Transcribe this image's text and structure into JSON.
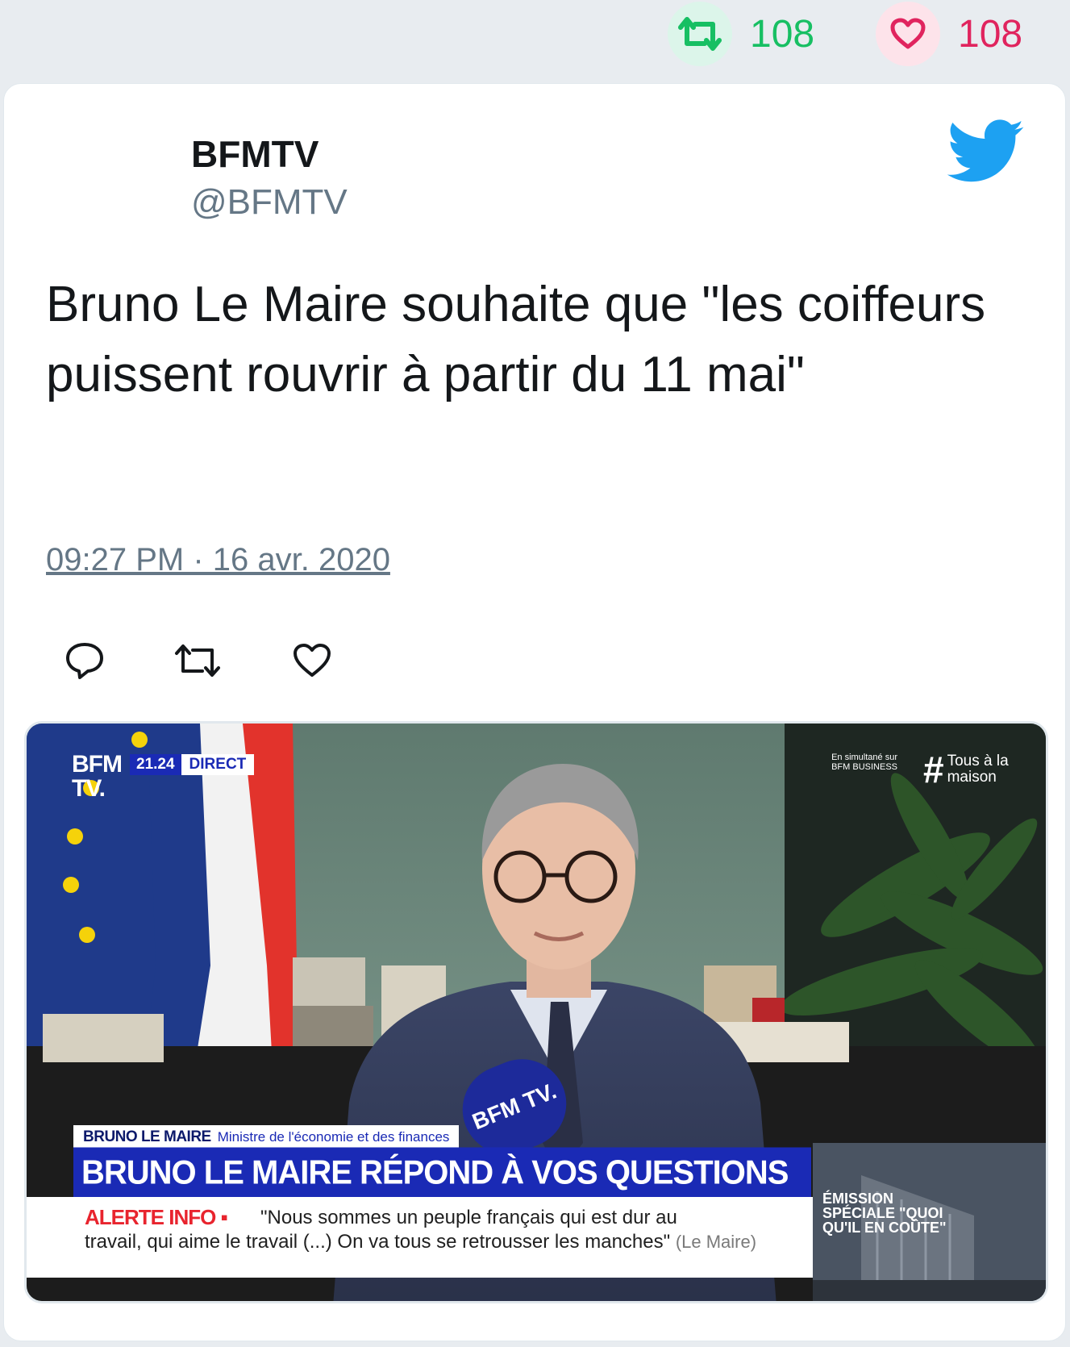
{
  "stats": {
    "retweets": "108",
    "likes": "108",
    "retweet_icon": "retweet-icon",
    "like_icon": "heart-icon"
  },
  "author": {
    "name": "BFMTV",
    "handle": "@BFMTV"
  },
  "tweet": {
    "text": "Bruno Le Maire souhaite que \"les coiffeurs puissent rouvrir à partir du 11 mai\"",
    "timestamp": "09:27 PM · 16 avr. 2020"
  },
  "actions": [
    "reply-icon",
    "retweet-icon",
    "like-icon"
  ],
  "media": {
    "channel_logo_line1": "BFM",
    "channel_logo_line2": "TV.",
    "live_time": "21.24",
    "live_label": "DIRECT",
    "simulcast": "En simultané sur BFM BUSINESS",
    "hashtag_symbol": "#",
    "hashtag_text_1": "Tous à la",
    "hashtag_text_2": "maison",
    "mic_label": "BFM TV.",
    "nameplate_name": "BRUNO LE MAIRE",
    "nameplate_role": "Ministre de l'économie et des finances",
    "headline": "BRUNO LE MAIRE RÉPOND À VOS QUESTIONS",
    "alert_label": "ALERTE INFO ▪",
    "alert_line1": "\"Nous sommes un peuple français qui est dur au",
    "alert_line2": "travail, qui aime le travail (...) On va tous se retrousser les manches\"",
    "alert_attribution": "(Le Maire)",
    "special_text": "ÉMISSION SPÉCIALE \"QUOI QU'IL EN COÛTE\""
  },
  "colors": {
    "retweet_green": "#17bf63",
    "like_red": "#e0245e",
    "twitter_blue": "#1da1f2",
    "bfm_blue": "#1a2ab5"
  }
}
